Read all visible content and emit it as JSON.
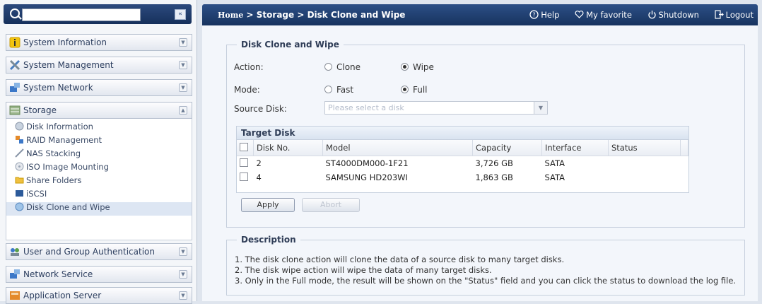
{
  "sidebar": {
    "search_placeholder": "",
    "collapse_glyph": "«",
    "nav": [
      {
        "label": "System Information",
        "icon": "info-icon"
      },
      {
        "label": "System Management",
        "icon": "tools-icon"
      },
      {
        "label": "System Network",
        "icon": "network-icon"
      },
      {
        "label": "Storage",
        "icon": "storage-icon"
      },
      {
        "label": "User and Group Authentication",
        "icon": "users-icon"
      },
      {
        "label": "Network Service",
        "icon": "network-service-icon"
      },
      {
        "label": "Application Server",
        "icon": "app-server-icon"
      }
    ],
    "storage_items": [
      {
        "label": "Disk Information"
      },
      {
        "label": "RAID Management"
      },
      {
        "label": "NAS Stacking"
      },
      {
        "label": "ISO Image Mounting"
      },
      {
        "label": "Share Folders"
      },
      {
        "label": "iSCSI"
      },
      {
        "label": "Disk Clone and Wipe"
      }
    ]
  },
  "header": {
    "breadcrumb_home": "Home",
    "breadcrumb_rest": " > Storage > Disk Clone and Wipe",
    "help": "Help",
    "favorite": "My favorite",
    "shutdown": "Shutdown",
    "logout": "Logout"
  },
  "form": {
    "title": "Disk Clone and Wipe",
    "action_label": "Action:",
    "action_options": [
      "Clone",
      "Wipe"
    ],
    "action_selected": "Wipe",
    "mode_label": "Mode:",
    "mode_options": [
      "Fast",
      "Full"
    ],
    "mode_selected": "Full",
    "source_label": "Source Disk:",
    "source_placeholder": "Please select a disk",
    "target_title": "Target Disk",
    "columns": [
      "Disk No.",
      "Model",
      "Capacity",
      "Interface",
      "Status"
    ],
    "rows": [
      {
        "disk": "2",
        "model": "ST4000DM000-1F21",
        "capacity": "3,726 GB",
        "interface": "SATA",
        "status": ""
      },
      {
        "disk": "4",
        "model": "SAMSUNG HD203WI",
        "capacity": "1,863 GB",
        "interface": "SATA",
        "status": ""
      }
    ],
    "apply": "Apply",
    "abort": "Abort"
  },
  "description": {
    "title": "Description",
    "lines": [
      "1. The disk clone action will clone the data of a source disk to many target disks.",
      "2. The disk wipe action will wipe the data of many target disks.",
      "3. Only in the Full mode, the result will be shown on the \"Status\" field and you can click the status to download the log file."
    ]
  },
  "colors": {
    "header_blue": "#1f3d6e",
    "accent": "#2c4f86"
  }
}
